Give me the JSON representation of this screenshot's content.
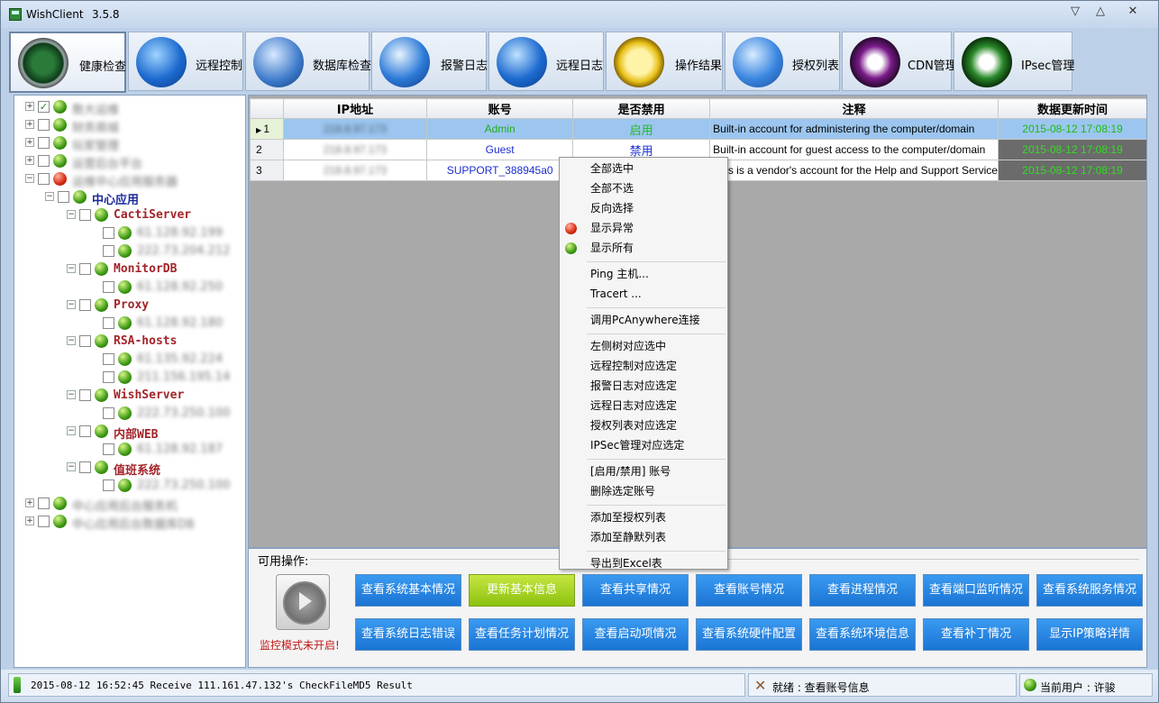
{
  "window": {
    "title": "WishClient",
    "version": "3.5.8",
    "controls": [
      "▽",
      "△",
      "✕"
    ]
  },
  "toolbar": [
    {
      "label": "健康检查",
      "icon": "radar-icon",
      "active": true
    },
    {
      "label": "远程控制",
      "icon": "globe-icon"
    },
    {
      "label": "数据库检查",
      "icon": "database-monitor-icon"
    },
    {
      "label": "报警日志",
      "icon": "megaphone-icon"
    },
    {
      "label": "远程日志",
      "icon": "wrench-globe-icon"
    },
    {
      "label": "操作结果",
      "icon": "hourglass-icon"
    },
    {
      "label": "授权列表",
      "icon": "servers-icon"
    },
    {
      "label": "CDN管理",
      "icon": "yin-yang-purple-icon"
    },
    {
      "label": "IPsec管理",
      "icon": "yin-yang-green-icon"
    }
  ],
  "tree": {
    "nodes": [
      {
        "label": "数大运维",
        "level": 0,
        "expander": "+",
        "checked": true,
        "status": "green",
        "blurred": true
      },
      {
        "label": "财务商城",
        "level": 0,
        "expander": "+",
        "status": "green",
        "blurred": true
      },
      {
        "label": "玩家管理",
        "level": 0,
        "expander": "+",
        "status": "green",
        "blurred": true
      },
      {
        "label": "运营后台平台",
        "level": 0,
        "expander": "+",
        "status": "green",
        "blurred": true
      },
      {
        "label": "运维中心应用服务器",
        "level": 0,
        "expander": "−",
        "status": "red",
        "blurred": true
      },
      {
        "label": "中心应用",
        "level": 1,
        "expander": "−",
        "status": "green",
        "kind": "center"
      },
      {
        "label": "CactiServer",
        "level": 2,
        "expander": "−",
        "status": "green",
        "kind": "group"
      },
      {
        "label": "61.128.92.199",
        "level": 3,
        "status": "green",
        "blurred": true
      },
      {
        "label": "222.73.204.212",
        "level": 3,
        "status": "green",
        "blurred": true
      },
      {
        "label": "MonitorDB",
        "level": 2,
        "expander": "−",
        "status": "green",
        "kind": "group"
      },
      {
        "label": "61.128.92.250",
        "level": 3,
        "status": "green",
        "blurred": true
      },
      {
        "label": "Proxy",
        "level": 2,
        "expander": "−",
        "status": "green",
        "kind": "group"
      },
      {
        "label": "61.128.92.180",
        "level": 3,
        "status": "green",
        "blurred": true
      },
      {
        "label": "RSA-hosts",
        "level": 2,
        "expander": "−",
        "status": "green",
        "kind": "group"
      },
      {
        "label": "61.135.92.224",
        "level": 3,
        "status": "green",
        "blurred": true
      },
      {
        "label": "211.156.195.14",
        "level": 3,
        "status": "green",
        "blurred": true
      },
      {
        "label": "WishServer",
        "level": 2,
        "expander": "−",
        "status": "green",
        "kind": "group"
      },
      {
        "label": "222.73.250.100",
        "level": 3,
        "status": "green",
        "blurred": true
      },
      {
        "label": "内部WEB",
        "level": 2,
        "expander": "−",
        "status": "green",
        "kind": "group"
      },
      {
        "label": "61.128.92.187",
        "level": 3,
        "status": "green",
        "blurred": true
      },
      {
        "label": "值班系统",
        "level": 2,
        "expander": "−",
        "status": "green",
        "kind": "group"
      },
      {
        "label": "222.73.250.100",
        "level": 3,
        "status": "green",
        "blurred": true
      },
      {
        "label": "中心应用后台服务机",
        "level": 0,
        "expander": "+",
        "status": "green",
        "blurred": true
      },
      {
        "label": "中心应用后台数据库DB",
        "level": 0,
        "expander": "+",
        "status": "green",
        "blurred": true
      }
    ]
  },
  "grid": {
    "columns": [
      "IP地址",
      "账号",
      "是否禁用",
      "注释",
      "数据更新时间"
    ],
    "rows": [
      {
        "num": "1",
        "ip": "218.8.97.173",
        "account": "Admin",
        "status": "启用",
        "note": "Built-in account for administering the computer/domain",
        "time": "2015-08-12 17:08:19",
        "selected": true
      },
      {
        "num": "2",
        "ip": "218.8.97.173",
        "account": "Guest",
        "status": "禁用",
        "note": "Built-in account for guest access to the computer/domain",
        "time": "2015-08-12 17:08:19"
      },
      {
        "num": "3",
        "ip": "218.8.97.173",
        "account": "SUPPORT_388945a0",
        "status": "禁用",
        "note": "This is a vendor's account for the Help and Support Service",
        "time": "2015-08-12 17:08:19"
      }
    ]
  },
  "context_menu": {
    "items": [
      {
        "label": "全部选中"
      },
      {
        "label": "全部不选"
      },
      {
        "label": "反向选择"
      },
      {
        "label": "显示异常",
        "icon": "red-dot-icon"
      },
      {
        "label": "显示所有",
        "icon": "green-dot-icon"
      },
      {
        "sep": true
      },
      {
        "label": "Ping 主机..."
      },
      {
        "label": "Tracert ..."
      },
      {
        "sep": true
      },
      {
        "label": "调用PcAnywhere连接"
      },
      {
        "sep": true
      },
      {
        "label": "左侧树对应选中"
      },
      {
        "label": "远程控制对应选定"
      },
      {
        "label": "报警日志对应选定"
      },
      {
        "label": "远程日志对应选定"
      },
      {
        "label": "授权列表对应选定"
      },
      {
        "label": "IPSec管理对应选定"
      },
      {
        "sep": true
      },
      {
        "label": "[启用/禁用] 账号"
      },
      {
        "label": "删除选定账号"
      },
      {
        "sep": true
      },
      {
        "label": "添加至授权列表"
      },
      {
        "label": "添加至静默列表"
      },
      {
        "sep": true
      },
      {
        "label": "导出到Excel表"
      }
    ]
  },
  "ops": {
    "title": "可用操作:",
    "monitor_status": "监控模式未开启!",
    "buttons_row1": [
      "查看系统基本情况",
      "更新基本信息",
      "查看共享情况",
      "查看账号情况",
      "查看进程情况",
      "查看端口监听情况",
      "查看系统服务情况"
    ],
    "buttons_row2": [
      "查看系统日志错误",
      "查看任务计划情况",
      "查看启动项情况",
      "查看系统硬件配置",
      "查看系统环境信息",
      "查看补丁情况",
      "显示IP策略详情"
    ],
    "highlighted": "更新基本信息"
  },
  "statusbar": {
    "log": "2015-08-12 16:52:45  Receive 111.161.47.132's CheckFileMD5 Result",
    "ready": "就绪 : 查看账号信息",
    "user": "当前用户 : 许骏"
  },
  "colors": {
    "accent": "#1a74d4",
    "highlight_btn": "#9cce20",
    "selected_row": "#9cc6ef",
    "time_text": "#33dd22",
    "alert": "#c01818"
  }
}
